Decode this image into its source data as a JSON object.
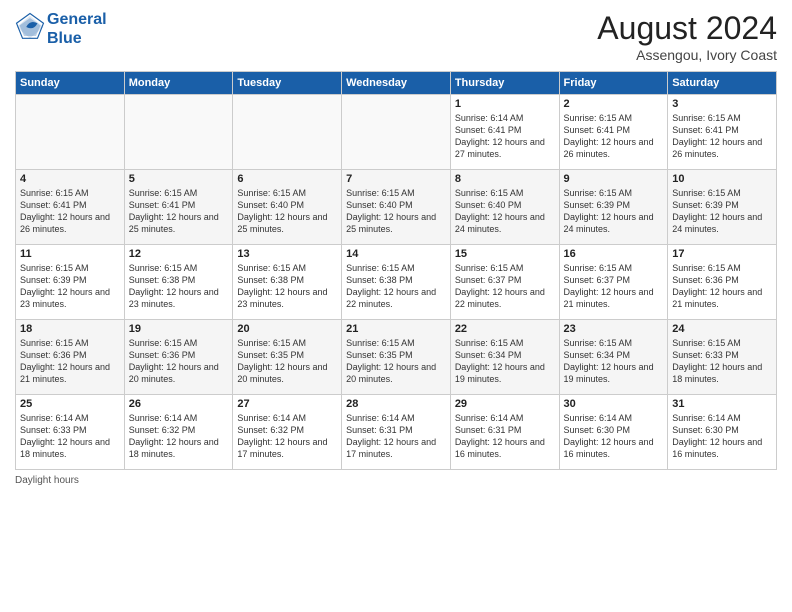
{
  "header": {
    "logo_line1": "General",
    "logo_line2": "Blue",
    "month_year": "August 2024",
    "location": "Assengou, Ivory Coast"
  },
  "days_of_week": [
    "Sunday",
    "Monday",
    "Tuesday",
    "Wednesday",
    "Thursday",
    "Friday",
    "Saturday"
  ],
  "weeks": [
    [
      {
        "day": "",
        "info": ""
      },
      {
        "day": "",
        "info": ""
      },
      {
        "day": "",
        "info": ""
      },
      {
        "day": "",
        "info": ""
      },
      {
        "day": "1",
        "info": "Sunrise: 6:14 AM\nSunset: 6:41 PM\nDaylight: 12 hours\nand 27 minutes."
      },
      {
        "day": "2",
        "info": "Sunrise: 6:15 AM\nSunset: 6:41 PM\nDaylight: 12 hours\nand 26 minutes."
      },
      {
        "day": "3",
        "info": "Sunrise: 6:15 AM\nSunset: 6:41 PM\nDaylight: 12 hours\nand 26 minutes."
      }
    ],
    [
      {
        "day": "4",
        "info": "Sunrise: 6:15 AM\nSunset: 6:41 PM\nDaylight: 12 hours\nand 26 minutes."
      },
      {
        "day": "5",
        "info": "Sunrise: 6:15 AM\nSunset: 6:41 PM\nDaylight: 12 hours\nand 25 minutes."
      },
      {
        "day": "6",
        "info": "Sunrise: 6:15 AM\nSunset: 6:40 PM\nDaylight: 12 hours\nand 25 minutes."
      },
      {
        "day": "7",
        "info": "Sunrise: 6:15 AM\nSunset: 6:40 PM\nDaylight: 12 hours\nand 25 minutes."
      },
      {
        "day": "8",
        "info": "Sunrise: 6:15 AM\nSunset: 6:40 PM\nDaylight: 12 hours\nand 24 minutes."
      },
      {
        "day": "9",
        "info": "Sunrise: 6:15 AM\nSunset: 6:39 PM\nDaylight: 12 hours\nand 24 minutes."
      },
      {
        "day": "10",
        "info": "Sunrise: 6:15 AM\nSunset: 6:39 PM\nDaylight: 12 hours\nand 24 minutes."
      }
    ],
    [
      {
        "day": "11",
        "info": "Sunrise: 6:15 AM\nSunset: 6:39 PM\nDaylight: 12 hours\nand 23 minutes."
      },
      {
        "day": "12",
        "info": "Sunrise: 6:15 AM\nSunset: 6:38 PM\nDaylight: 12 hours\nand 23 minutes."
      },
      {
        "day": "13",
        "info": "Sunrise: 6:15 AM\nSunset: 6:38 PM\nDaylight: 12 hours\nand 23 minutes."
      },
      {
        "day": "14",
        "info": "Sunrise: 6:15 AM\nSunset: 6:38 PM\nDaylight: 12 hours\nand 22 minutes."
      },
      {
        "day": "15",
        "info": "Sunrise: 6:15 AM\nSunset: 6:37 PM\nDaylight: 12 hours\nand 22 minutes."
      },
      {
        "day": "16",
        "info": "Sunrise: 6:15 AM\nSunset: 6:37 PM\nDaylight: 12 hours\nand 21 minutes."
      },
      {
        "day": "17",
        "info": "Sunrise: 6:15 AM\nSunset: 6:36 PM\nDaylight: 12 hours\nand 21 minutes."
      }
    ],
    [
      {
        "day": "18",
        "info": "Sunrise: 6:15 AM\nSunset: 6:36 PM\nDaylight: 12 hours\nand 21 minutes."
      },
      {
        "day": "19",
        "info": "Sunrise: 6:15 AM\nSunset: 6:36 PM\nDaylight: 12 hours\nand 20 minutes."
      },
      {
        "day": "20",
        "info": "Sunrise: 6:15 AM\nSunset: 6:35 PM\nDaylight: 12 hours\nand 20 minutes."
      },
      {
        "day": "21",
        "info": "Sunrise: 6:15 AM\nSunset: 6:35 PM\nDaylight: 12 hours\nand 20 minutes."
      },
      {
        "day": "22",
        "info": "Sunrise: 6:15 AM\nSunset: 6:34 PM\nDaylight: 12 hours\nand 19 minutes."
      },
      {
        "day": "23",
        "info": "Sunrise: 6:15 AM\nSunset: 6:34 PM\nDaylight: 12 hours\nand 19 minutes."
      },
      {
        "day": "24",
        "info": "Sunrise: 6:15 AM\nSunset: 6:33 PM\nDaylight: 12 hours\nand 18 minutes."
      }
    ],
    [
      {
        "day": "25",
        "info": "Sunrise: 6:14 AM\nSunset: 6:33 PM\nDaylight: 12 hours\nand 18 minutes."
      },
      {
        "day": "26",
        "info": "Sunrise: 6:14 AM\nSunset: 6:32 PM\nDaylight: 12 hours\nand 18 minutes."
      },
      {
        "day": "27",
        "info": "Sunrise: 6:14 AM\nSunset: 6:32 PM\nDaylight: 12 hours\nand 17 minutes."
      },
      {
        "day": "28",
        "info": "Sunrise: 6:14 AM\nSunset: 6:31 PM\nDaylight: 12 hours\nand 17 minutes."
      },
      {
        "day": "29",
        "info": "Sunrise: 6:14 AM\nSunset: 6:31 PM\nDaylight: 12 hours\nand 16 minutes."
      },
      {
        "day": "30",
        "info": "Sunrise: 6:14 AM\nSunset: 6:30 PM\nDaylight: 12 hours\nand 16 minutes."
      },
      {
        "day": "31",
        "info": "Sunrise: 6:14 AM\nSunset: 6:30 PM\nDaylight: 12 hours\nand 16 minutes."
      }
    ]
  ],
  "footer": {
    "daylight_label": "Daylight hours"
  }
}
